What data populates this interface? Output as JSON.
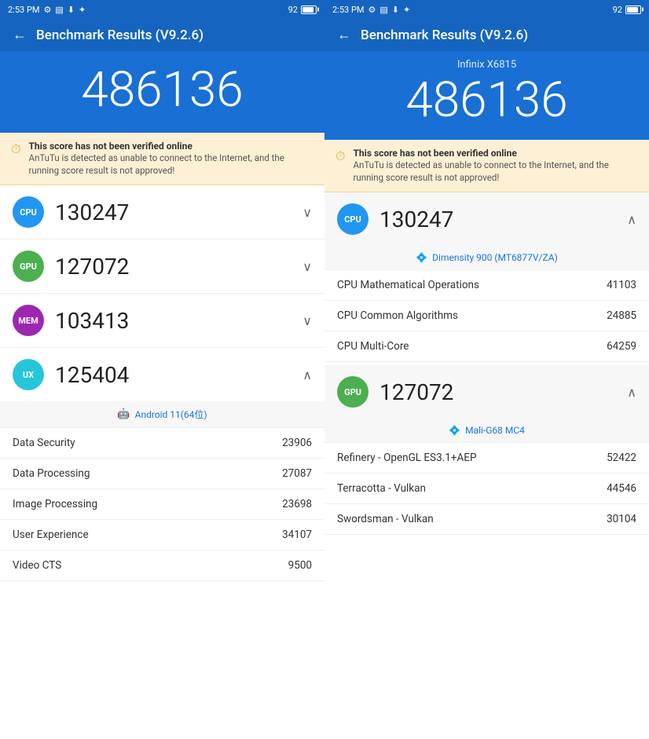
{
  "statusBar": {
    "time": "2:53 PM",
    "batteryLevel": "92",
    "batteryWidth": "85%"
  },
  "header": {
    "backLabel": "←",
    "title": "Benchmark Results (V9.2.6)"
  },
  "left": {
    "mainScore": "486136",
    "warning": {
      "title": "This score has not been verified online",
      "body": "AnTuTu is detected as unable to connect to the Internet, and the running score result is not approved!"
    },
    "categories": [
      {
        "id": "CPU",
        "score": "130247",
        "expanded": false
      },
      {
        "id": "GPU",
        "score": "127072",
        "expanded": false
      },
      {
        "id": "MEM",
        "score": "103413",
        "expanded": false
      },
      {
        "id": "UX",
        "score": "125404",
        "expanded": true
      }
    ],
    "androidBadge": "Android 11(64位)",
    "uxRows": [
      {
        "label": "Data Security",
        "value": "23906"
      },
      {
        "label": "Data Processing",
        "value": "27087"
      },
      {
        "label": "Image Processing",
        "value": "23698"
      },
      {
        "label": "User Experience",
        "value": "34107"
      },
      {
        "label": "Video CTS",
        "value": "9500"
      }
    ]
  },
  "right": {
    "deviceName": "Infinix X6815",
    "mainScore": "486136",
    "warning": {
      "title": "This score has not been verified online",
      "body": "AnTuTu is detected as unable to connect to the Internet, and the running score result is not approved!"
    },
    "cpuSection": {
      "id": "CPU",
      "score": "130247",
      "chipLabel": "Dimensity 900 (MT6877V/ZA)",
      "rows": [
        {
          "label": "CPU Mathematical Operations",
          "value": "41103"
        },
        {
          "label": "CPU Common Algorithms",
          "value": "24885"
        },
        {
          "label": "CPU Multi-Core",
          "value": "64259"
        }
      ]
    },
    "gpuSection": {
      "id": "GPU",
      "score": "127072",
      "chipLabel": "Mali-G68 MC4",
      "rows": [
        {
          "label": "Refinery - OpenGL ES3.1+AEP",
          "value": "52422"
        },
        {
          "label": "Terracotta - Vulkan",
          "value": "44546"
        },
        {
          "label": "Swordsman - Vulkan",
          "value": "30104"
        }
      ]
    }
  }
}
